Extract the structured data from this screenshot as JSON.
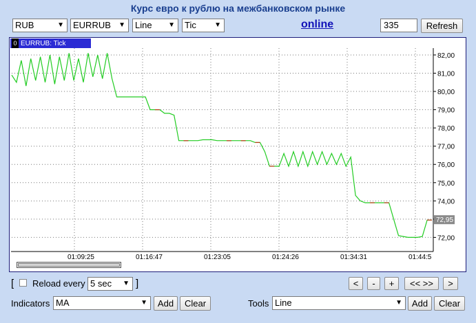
{
  "page_title": "Курс евро к рублю на межбанковском рынке",
  "toolbar": {
    "currency": "RUB",
    "pair": "EURRUB",
    "chart_type": "Line",
    "period": "Tic",
    "online_link": "online",
    "count_value": "335",
    "refresh_label": "Refresh"
  },
  "legend": {
    "index": "0",
    "label": "EURRUB: Tick"
  },
  "chart_data": {
    "type": "line",
    "series": [
      {
        "name": "EURRUB: Tick",
        "values": [
          80.9,
          80.5,
          81.7,
          80.3,
          81.8,
          80.6,
          81.9,
          80.5,
          82.0,
          80.4,
          81.9,
          80.6,
          82.1,
          80.6,
          81.8,
          80.5,
          82.1,
          80.8,
          82.0,
          80.7,
          82.1,
          80.7,
          79.7,
          79.7,
          79.7,
          79.7,
          79.7,
          79.7,
          79.7,
          79.0,
          79.0,
          79.0,
          78.8,
          78.8,
          78.7,
          77.3,
          77.3,
          77.3,
          77.3,
          77.3,
          77.35,
          77.35,
          77.35,
          77.3,
          77.3,
          77.3,
          77.3,
          77.3,
          77.3,
          77.3,
          77.3,
          77.2,
          77.2,
          76.7,
          75.9,
          75.9,
          75.9,
          76.6,
          75.9,
          76.7,
          75.9,
          76.7,
          75.9,
          76.7,
          76.0,
          76.7,
          76.0,
          76.6,
          76.0,
          76.6,
          75.9,
          76.4,
          74.3,
          74.0,
          73.9,
          73.9,
          73.9,
          73.9,
          73.9,
          73.9,
          73.0,
          72.1,
          72.05,
          72.0,
          72.0,
          72.0,
          72.05,
          72.95,
          72.95
        ]
      }
    ],
    "x_ticks": [
      "01:09:25",
      "01:16:47",
      "01:23:05",
      "01:24:26",
      "01:34:31",
      "01:44:5"
    ],
    "y_ticks": [
      "82,00",
      "81,00",
      "80,00",
      "79,00",
      "78,00",
      "77,00",
      "76,00",
      "75,00",
      "74,00",
      "73,00",
      "72,00"
    ],
    "ylim": [
      71.3,
      82.3
    ],
    "last_value_label": "72,95",
    "grid": true,
    "line_color": "#22cc22",
    "highlight_color": "#c03a1a"
  },
  "controls": {
    "bracket_open": "[",
    "bracket_close": "]",
    "reload_label": "Reload every",
    "reload_interval": "5 sec",
    "nav": {
      "left": "<",
      "minus": "-",
      "plus": "+",
      "zoom": "<< >>",
      "right": ">"
    },
    "indicators_label": "Indicators",
    "indicators_value": "MA",
    "tools_label": "Tools",
    "tools_value": "Line",
    "add_label": "Add",
    "clear_label": "Clear"
  }
}
